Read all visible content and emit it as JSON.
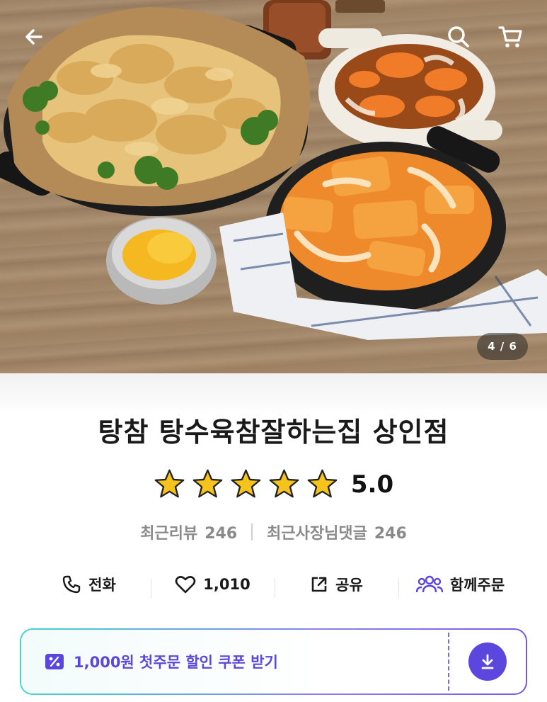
{
  "hero": {
    "image_counter": "4 / 6",
    "icons": {
      "back": "arrow-left-icon",
      "search": "search-icon",
      "cart": "cart-icon"
    }
  },
  "store": {
    "name": "탕참 탕수육참잘하는집 상인점",
    "rating": "5.0",
    "stars": 5,
    "recent_reviews_label": "최근리뷰",
    "recent_reviews_count": "246",
    "owner_replies_label": "최근사장님댓글",
    "owner_replies_count": "246"
  },
  "actions": {
    "call_label": "전화",
    "favorite_count": "1,010",
    "share_label": "공유",
    "group_order_label": "함께주문"
  },
  "coupon": {
    "text": "1,000원 첫주문 할인 쿠폰 받기",
    "icons": {
      "left": "percent-coupon-icon",
      "right": "download-icon"
    }
  },
  "colors": {
    "accent": "#5b47de",
    "star": "#f6c21c",
    "coupon_gradient_start": "#3fd7cc",
    "coupon_gradient_end": "#6f5ce6"
  }
}
